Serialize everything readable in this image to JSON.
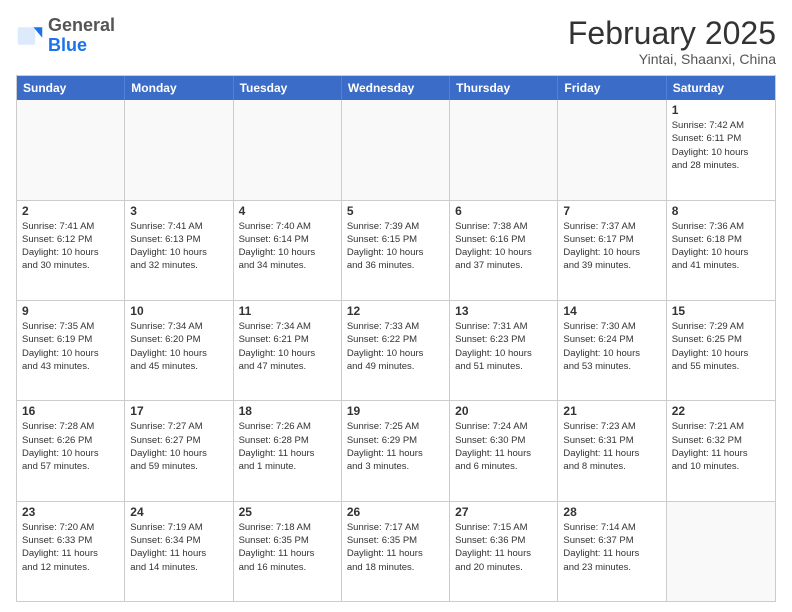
{
  "header": {
    "logo": {
      "general": "General",
      "blue": "Blue"
    },
    "title": "February 2025",
    "location": "Yintai, Shaanxi, China"
  },
  "weekdays": [
    "Sunday",
    "Monday",
    "Tuesday",
    "Wednesday",
    "Thursday",
    "Friday",
    "Saturday"
  ],
  "weeks": [
    [
      {
        "day": "",
        "info": ""
      },
      {
        "day": "",
        "info": ""
      },
      {
        "day": "",
        "info": ""
      },
      {
        "day": "",
        "info": ""
      },
      {
        "day": "",
        "info": ""
      },
      {
        "day": "",
        "info": ""
      },
      {
        "day": "1",
        "info": "Sunrise: 7:42 AM\nSunset: 6:11 PM\nDaylight: 10 hours\nand 28 minutes."
      }
    ],
    [
      {
        "day": "2",
        "info": "Sunrise: 7:41 AM\nSunset: 6:12 PM\nDaylight: 10 hours\nand 30 minutes."
      },
      {
        "day": "3",
        "info": "Sunrise: 7:41 AM\nSunset: 6:13 PM\nDaylight: 10 hours\nand 32 minutes."
      },
      {
        "day": "4",
        "info": "Sunrise: 7:40 AM\nSunset: 6:14 PM\nDaylight: 10 hours\nand 34 minutes."
      },
      {
        "day": "5",
        "info": "Sunrise: 7:39 AM\nSunset: 6:15 PM\nDaylight: 10 hours\nand 36 minutes."
      },
      {
        "day": "6",
        "info": "Sunrise: 7:38 AM\nSunset: 6:16 PM\nDaylight: 10 hours\nand 37 minutes."
      },
      {
        "day": "7",
        "info": "Sunrise: 7:37 AM\nSunset: 6:17 PM\nDaylight: 10 hours\nand 39 minutes."
      },
      {
        "day": "8",
        "info": "Sunrise: 7:36 AM\nSunset: 6:18 PM\nDaylight: 10 hours\nand 41 minutes."
      }
    ],
    [
      {
        "day": "9",
        "info": "Sunrise: 7:35 AM\nSunset: 6:19 PM\nDaylight: 10 hours\nand 43 minutes."
      },
      {
        "day": "10",
        "info": "Sunrise: 7:34 AM\nSunset: 6:20 PM\nDaylight: 10 hours\nand 45 minutes."
      },
      {
        "day": "11",
        "info": "Sunrise: 7:34 AM\nSunset: 6:21 PM\nDaylight: 10 hours\nand 47 minutes."
      },
      {
        "day": "12",
        "info": "Sunrise: 7:33 AM\nSunset: 6:22 PM\nDaylight: 10 hours\nand 49 minutes."
      },
      {
        "day": "13",
        "info": "Sunrise: 7:31 AM\nSunset: 6:23 PM\nDaylight: 10 hours\nand 51 minutes."
      },
      {
        "day": "14",
        "info": "Sunrise: 7:30 AM\nSunset: 6:24 PM\nDaylight: 10 hours\nand 53 minutes."
      },
      {
        "day": "15",
        "info": "Sunrise: 7:29 AM\nSunset: 6:25 PM\nDaylight: 10 hours\nand 55 minutes."
      }
    ],
    [
      {
        "day": "16",
        "info": "Sunrise: 7:28 AM\nSunset: 6:26 PM\nDaylight: 10 hours\nand 57 minutes."
      },
      {
        "day": "17",
        "info": "Sunrise: 7:27 AM\nSunset: 6:27 PM\nDaylight: 10 hours\nand 59 minutes."
      },
      {
        "day": "18",
        "info": "Sunrise: 7:26 AM\nSunset: 6:28 PM\nDaylight: 11 hours\nand 1 minute."
      },
      {
        "day": "19",
        "info": "Sunrise: 7:25 AM\nSunset: 6:29 PM\nDaylight: 11 hours\nand 3 minutes."
      },
      {
        "day": "20",
        "info": "Sunrise: 7:24 AM\nSunset: 6:30 PM\nDaylight: 11 hours\nand 6 minutes."
      },
      {
        "day": "21",
        "info": "Sunrise: 7:23 AM\nSunset: 6:31 PM\nDaylight: 11 hours\nand 8 minutes."
      },
      {
        "day": "22",
        "info": "Sunrise: 7:21 AM\nSunset: 6:32 PM\nDaylight: 11 hours\nand 10 minutes."
      }
    ],
    [
      {
        "day": "23",
        "info": "Sunrise: 7:20 AM\nSunset: 6:33 PM\nDaylight: 11 hours\nand 12 minutes."
      },
      {
        "day": "24",
        "info": "Sunrise: 7:19 AM\nSunset: 6:34 PM\nDaylight: 11 hours\nand 14 minutes."
      },
      {
        "day": "25",
        "info": "Sunrise: 7:18 AM\nSunset: 6:35 PM\nDaylight: 11 hours\nand 16 minutes."
      },
      {
        "day": "26",
        "info": "Sunrise: 7:17 AM\nSunset: 6:35 PM\nDaylight: 11 hours\nand 18 minutes."
      },
      {
        "day": "27",
        "info": "Sunrise: 7:15 AM\nSunset: 6:36 PM\nDaylight: 11 hours\nand 20 minutes."
      },
      {
        "day": "28",
        "info": "Sunrise: 7:14 AM\nSunset: 6:37 PM\nDaylight: 11 hours\nand 23 minutes."
      },
      {
        "day": "",
        "info": ""
      }
    ]
  ]
}
